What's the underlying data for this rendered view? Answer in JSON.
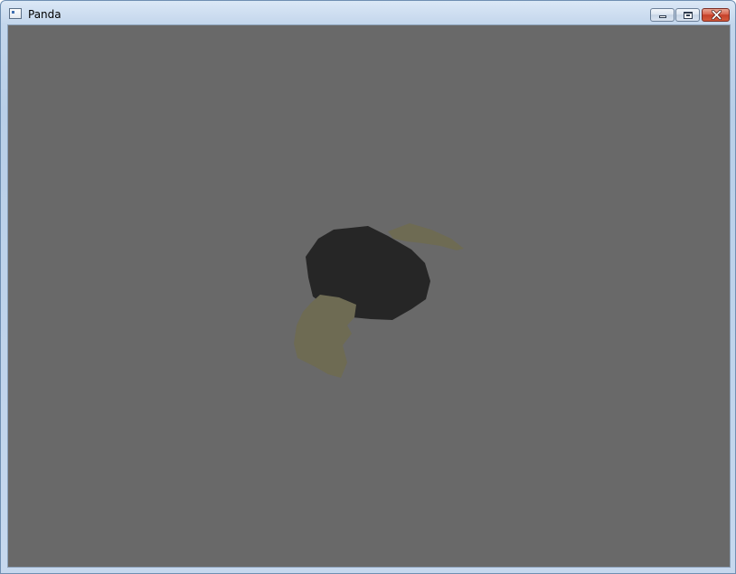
{
  "window": {
    "title": "Panda",
    "icon": "app-window-icon",
    "controls": {
      "minimize": "minimize-icon",
      "maximize": "maximize-icon",
      "close": "close-icon"
    }
  },
  "viewport": {
    "background": "#696969",
    "scene_colors": {
      "head": "#262626",
      "ear": "#6e6b53"
    }
  }
}
